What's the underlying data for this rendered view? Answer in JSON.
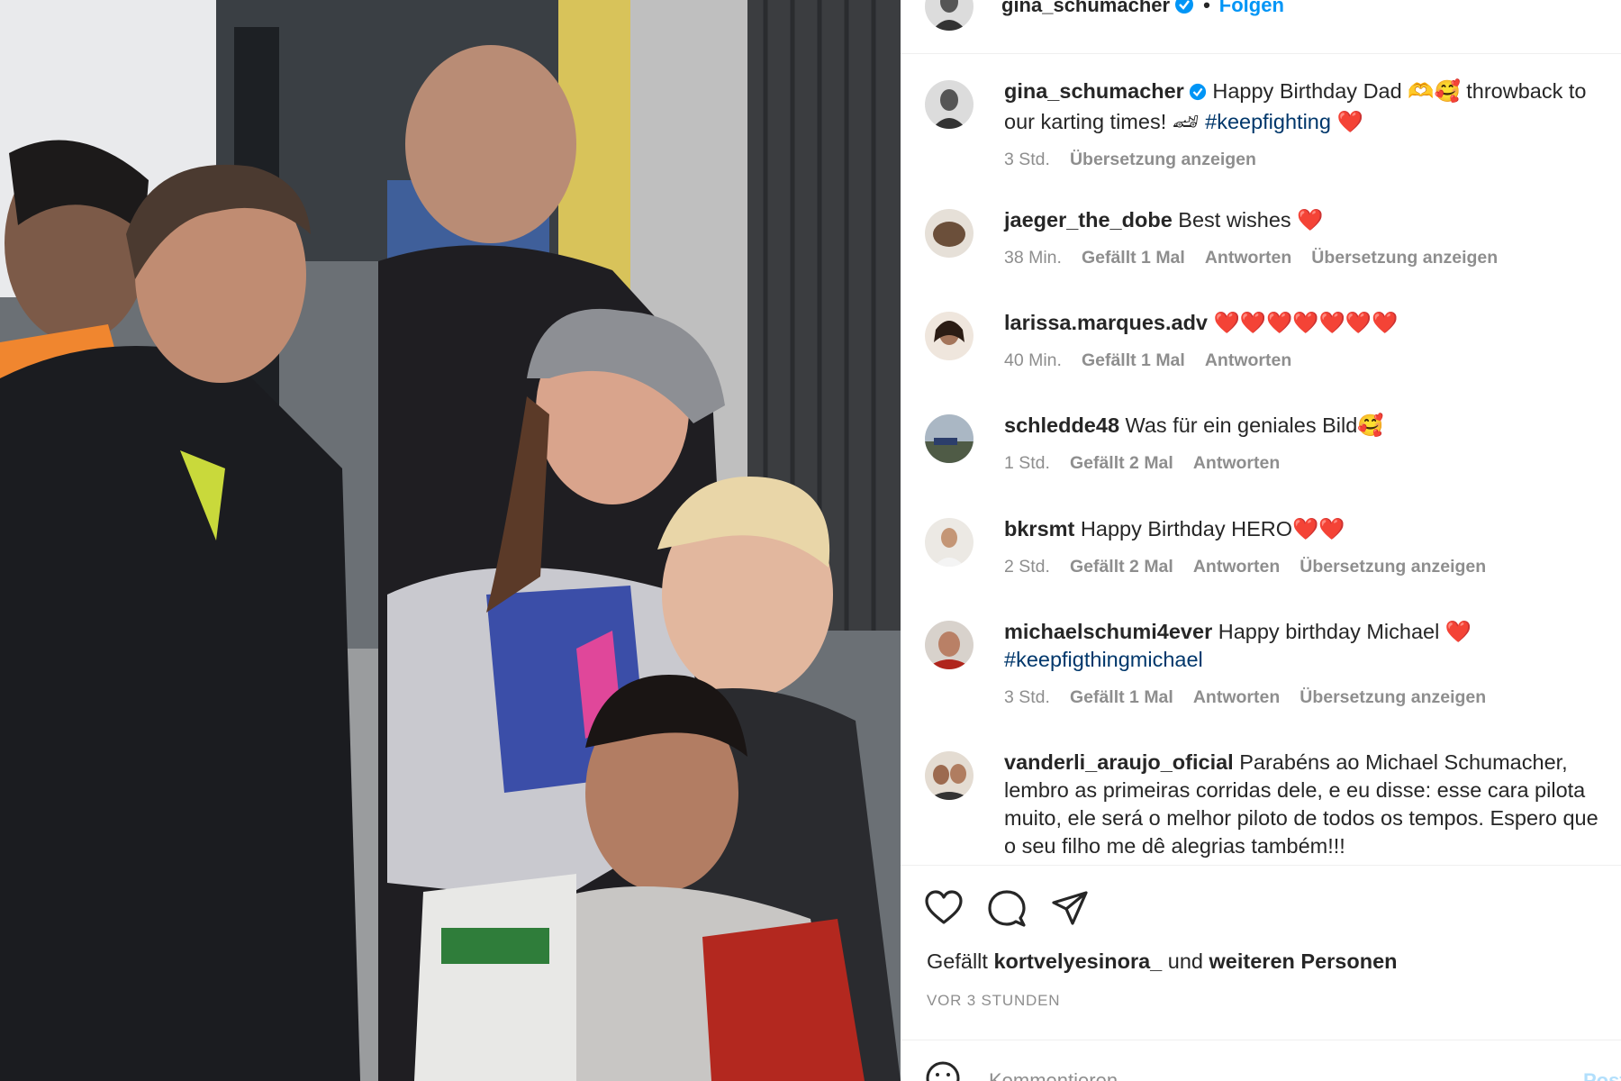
{
  "post": {
    "author": "gina_schumacher",
    "follow_label": "Folgen",
    "separator": "•"
  },
  "caption": {
    "username": "gina_schumacher",
    "text_a": "Happy Birthday Dad 🫶🥰 throwback to our karting times! 🏎 ",
    "hashtag": "#keepfighting",
    "text_b": " ❤️",
    "time": "3 Std.",
    "translate": "Übersetzung anzeigen"
  },
  "comments": [
    {
      "username": "jaeger_the_dobe",
      "text": "Best wishes ❤️",
      "time": "38 Min.",
      "likes": "Gefällt 1 Mal",
      "reply": "Antworten",
      "translate": "Übersetzung anzeigen"
    },
    {
      "username": "larissa.marques.adv",
      "text": "❤️❤️❤️❤️❤️❤️❤️",
      "time": "40 Min.",
      "likes": "Gefällt 1 Mal",
      "reply": "Antworten"
    },
    {
      "username": "schledde48",
      "text": "Was für ein geniales Bild🥰",
      "time": "1 Std.",
      "likes": "Gefällt 2 Mal",
      "reply": "Antworten"
    },
    {
      "username": "bkrsmt",
      "text": "Happy Birthday HERO❤️❤️",
      "time": "2 Std.",
      "likes": "Gefällt 2 Mal",
      "reply": "Antworten",
      "translate": "Übersetzung anzeigen"
    },
    {
      "username": "michaelschumi4ever",
      "text": "Happy birthday Michael ❤️ ",
      "hashtag": "#keepfigthingmichael",
      "time": "3 Std.",
      "likes": "Gefällt 1 Mal",
      "reply": "Antworten",
      "translate": "Übersetzung anzeigen"
    },
    {
      "username": "vanderli_araujo_oficial",
      "text": "Parabéns ao Michael Schumacher, lembro as primeiras corridas dele, e eu disse: esse cara pilota muito, ele será o melhor piloto de todos os tempos. Espero que o seu filho me dê alegrias também!!!"
    }
  ],
  "likes_line": {
    "prefix": "Gefällt ",
    "user": "kortvelyesinora_",
    "middle": " und ",
    "others": "weiteren Personen"
  },
  "post_age": "VOR 3 STUNDEN",
  "composer": {
    "placeholder": "Kommentieren ...",
    "post_label": "Posten"
  },
  "icons": {
    "verified": "verified-badge-icon",
    "like": "heart-icon",
    "comment": "comment-bubble-icon",
    "share": "paper-plane-icon",
    "emoji": "emoji-smiley-icon"
  },
  "colors": {
    "link": "#0095f6",
    "hashtag": "#00376b",
    "muted": "#8e8e8e",
    "text": "#262626"
  }
}
